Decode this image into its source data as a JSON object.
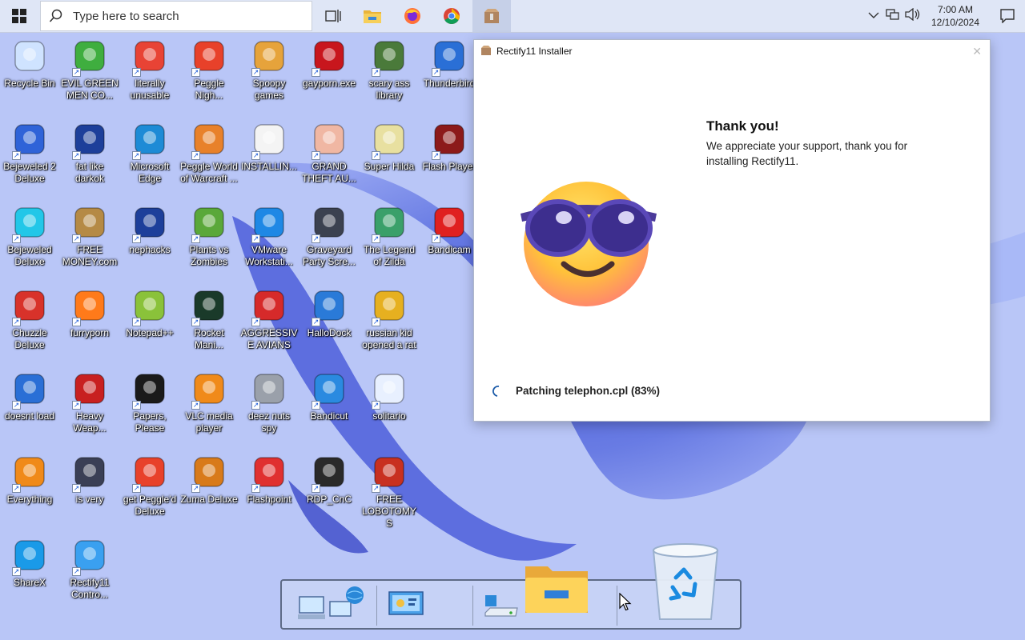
{
  "taskbar": {
    "search_placeholder": "Type here to search",
    "apps": [
      {
        "name": "task-view-icon"
      },
      {
        "name": "file-explorer-icon"
      },
      {
        "name": "firefox-icon"
      },
      {
        "name": "chrome-icon"
      },
      {
        "name": "rectify11-installer-icon",
        "active": true
      }
    ],
    "clock_time": "7:00 AM",
    "clock_date": "12/10/2024"
  },
  "desktop_icons": [
    {
      "label": "Recycle Bin",
      "icon": "recycle-bin-icon",
      "color": "#cfe3ff"
    },
    {
      "label": "EVIL GREEN MEN CO...",
      "icon": "green-men-icon",
      "color": "#3fae3f"
    },
    {
      "label": "literally unusable",
      "icon": "chrome-icon",
      "color": "#e84335"
    },
    {
      "label": "Peggle Nigh...",
      "icon": "peggle-icon",
      "color": "#e8412a"
    },
    {
      "label": "Spoopy games",
      "icon": "folder-icon",
      "color": "#e6a33b"
    },
    {
      "label": "gayporn.exe",
      "icon": "flash-icon",
      "color": "#c8161d"
    },
    {
      "label": "scary ass library",
      "icon": "library-icon",
      "color": "#4a7a3a"
    },
    {
      "label": "Thunderbird",
      "icon": "thunderbird-icon",
      "color": "#2a6fd6"
    },
    {
      "label": "Bejeweled 2 Deluxe",
      "icon": "bejeweled2-icon",
      "color": "#2f63d8"
    },
    {
      "label": "fat like darkok",
      "icon": "mpi-icon",
      "color": "#1d3f9a"
    },
    {
      "label": "Microsoft Edge",
      "icon": "edge-icon",
      "color": "#1d8bd6"
    },
    {
      "label": "Peggle World of Warcraft ...",
      "icon": "peggle-wow-icon",
      "color": "#e8812a"
    },
    {
      "label": "INSTALLIN...",
      "icon": "text-file-icon",
      "color": "#f4f4f4"
    },
    {
      "label": "GRAND THEFT AU...",
      "icon": "anime-girl-icon",
      "color": "#f0b7a3"
    },
    {
      "label": "Super Hilda",
      "icon": "pixel-art-icon",
      "color": "#e8e0a0"
    },
    {
      "label": "Flash Player",
      "icon": "flash-icon",
      "color": "#8c1a1a"
    },
    {
      "label": "Bejeweled Deluxe",
      "icon": "gem-icon",
      "color": "#22c7e8"
    },
    {
      "label": "FREE MONEY.com",
      "icon": "money-bag-icon",
      "color": "#b58a45"
    },
    {
      "label": "nephacks",
      "icon": "mpi-icon",
      "color": "#1d3f9a"
    },
    {
      "label": "Plants vs Zombies",
      "icon": "pvz-icon",
      "color": "#5aa83a"
    },
    {
      "label": "VMware Workstati...",
      "icon": "vmware-icon",
      "color": "#1e88e5"
    },
    {
      "label": "Graveyard Party Scre...",
      "icon": "graveyard-icon",
      "color": "#3b4150"
    },
    {
      "label": "The Legend of Zilda",
      "icon": "zilda-icon",
      "color": "#3aa06a"
    },
    {
      "label": "Bandicam",
      "icon": "bandicam-icon",
      "color": "#e02020"
    },
    {
      "label": "Chuzzle Deluxe",
      "icon": "chuzzle-icon",
      "color": "#d8322a"
    },
    {
      "label": "furryporn",
      "icon": "firefox-icon",
      "color": "#ff7a1a"
    },
    {
      "label": "Notepad++",
      "icon": "notepadpp-icon",
      "color": "#8ac23a"
    },
    {
      "label": "Rocket Mani...",
      "icon": "rocket-icon",
      "color": "#1a3a2a"
    },
    {
      "label": "AGGRESSIVE AVIANS",
      "icon": "angry-bird-icon",
      "color": "#d62a2a"
    },
    {
      "label": "HalloDock",
      "icon": "windows-shield-icon",
      "color": "#2a7ad8"
    },
    {
      "label": "russian kid opened a rat",
      "icon": "de-icon",
      "color": "#e6b020"
    },
    {
      "label": "doesnt load",
      "icon": "thunderbird-icon",
      "color": "#2a6fd6"
    },
    {
      "label": "Heavy Weap...",
      "icon": "radiation-icon",
      "color": "#c82020"
    },
    {
      "label": "Papers, Please",
      "icon": "papers-please-icon",
      "color": "#1a1a1a"
    },
    {
      "label": "VLC media player",
      "icon": "vlc-icon",
      "color": "#f08a1a"
    },
    {
      "label": "deez nuts spy",
      "icon": "windows-stack-icon",
      "color": "#9aa0aa"
    },
    {
      "label": "Bandicut",
      "icon": "bandicut-icon",
      "color": "#2a8ae0"
    },
    {
      "label": "solitario",
      "icon": "solitaire-icon",
      "color": "#e8f0ff"
    },
    {
      "label": "Everything",
      "icon": "magnifier-icon",
      "color": "#f08a1a"
    },
    {
      "label": "is very",
      "icon": "mpi-shield-icon",
      "color": "#3a3f55"
    },
    {
      "label": "get Peggle'd Deluxe",
      "icon": "peggle-icon",
      "color": "#e8412a"
    },
    {
      "label": "Zuma Deluxe",
      "icon": "zuma-icon",
      "color": "#d87a1a"
    },
    {
      "label": "Flashpoint",
      "icon": "flashpoint-icon",
      "color": "#e03030"
    },
    {
      "label": "RDP_CnC",
      "icon": "rdp-icon",
      "color": "#2a2a2a"
    },
    {
      "label": "FREE LOBOTOMYS",
      "icon": "lobotomy-icon",
      "color": "#c83020"
    },
    {
      "label": "ShareX",
      "icon": "sharex-icon",
      "color": "#1a9ae8"
    },
    {
      "label": "Rectify11 Contro...",
      "icon": "windows11-icon",
      "color": "#3aa0f0"
    }
  ],
  "installer": {
    "title": "Rectify11 Installer",
    "close_label": "✕",
    "heading": "Thank you!",
    "message": "We appreciate your support, thank you for installing Rectify11.",
    "progress_text": "Patching telephon.cpl (83%)",
    "emoji": "sunglasses-emoji-icon"
  },
  "dock": {
    "items": [
      {
        "name": "network-computer-icon"
      },
      {
        "name": "control-panel-icon"
      },
      {
        "name": "drive-icon"
      },
      {
        "name": "folder-icon"
      },
      {
        "name": "recycle-bin-icon"
      }
    ]
  },
  "colors": {
    "wallpaper": "#b9c6f7",
    "bloom": "#5a6ee0",
    "taskbar": "#dfe6f6"
  }
}
